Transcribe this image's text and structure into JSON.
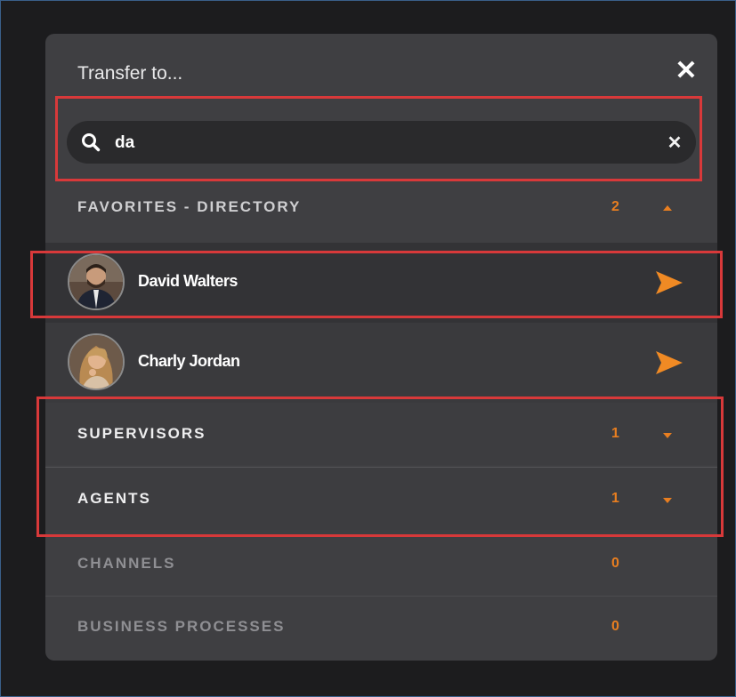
{
  "dialog": {
    "title": "Transfer to...",
    "close_icon": "close-icon"
  },
  "search": {
    "value": "da",
    "icon": "search-icon",
    "clear_icon": "clear-icon"
  },
  "favorites": {
    "label": "FAVORITES - DIRECTORY",
    "count": "2",
    "expanded": true,
    "contacts": [
      {
        "name": "David Walters",
        "action_icon": "send-icon"
      },
      {
        "name": "Charly Jordan",
        "action_icon": "send-icon"
      }
    ]
  },
  "sections": [
    {
      "label": "SUPERVISORS",
      "count": "1",
      "expanded": false
    },
    {
      "label": "AGENTS",
      "count": "1",
      "expanded": false
    },
    {
      "label": "CHANNELS",
      "count": "0"
    },
    {
      "label": "BUSINESS PROCESSES",
      "count": "0"
    }
  ],
  "colors": {
    "accent": "#e87e20",
    "highlight": "#d8393a",
    "panel": "#3f3f42"
  }
}
